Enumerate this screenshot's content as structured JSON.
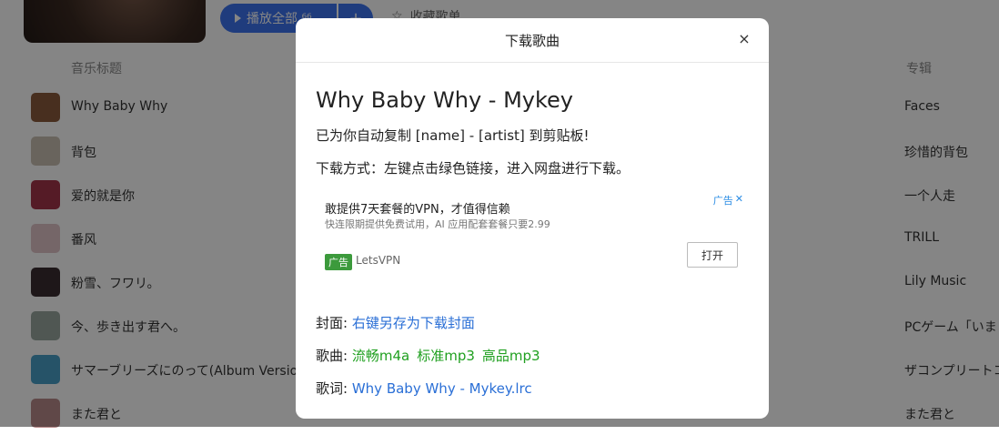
{
  "background": {
    "play_all_label": "播放全部 ⁶⁶",
    "add_label": "+",
    "favorite_label": "收藏歌单",
    "col_title_label": "音乐标题",
    "col_album_label": "专辑",
    "songs": [
      {
        "title": "Why Baby Why",
        "album": "Faces",
        "thumb_color": "#8a5a3c"
      },
      {
        "title": "背包",
        "album": "珍惜的背包",
        "thumb_color": "#c9c0b2"
      },
      {
        "title": "爱的就是你",
        "album": "一个人走",
        "thumb_color": "#a3344a"
      },
      {
        "title": "番风",
        "album": "TRILL",
        "thumb_color": "#e0c4c8"
      },
      {
        "title": "粉雪、フワリ。",
        "album": "Lily Music",
        "thumb_color": "#3a2c30"
      },
      {
        "title": "今、歩き出す君へ。",
        "album": "PCゲーム「いま",
        "thumb_color": "#9aa8a0"
      },
      {
        "title": "サマーブリーズにのって(Album Version",
        "album": "ザコンプリートコ",
        "thumb_color": "#4aa0c8"
      },
      {
        "title": "また君と",
        "album": "また君と",
        "thumb_color": "#b88a8a"
      }
    ]
  },
  "modal": {
    "title": "下载歌曲",
    "close_label": "×",
    "song_heading": "Why Baby Why - Mykey",
    "copy_notice": "已为你自动复制 [name] - [artist] 到剪贴板!",
    "download_hint": "下载方式：左键点击绿色链接，进入网盘进行下载。",
    "ad": {
      "title": "敢提供7天套餐的VPN，才值得信赖",
      "subtitle": "快连限期提供免费试用，AI 应用配套套餐只要2.99",
      "mark_label": "广告",
      "mark_close": "✕",
      "tag_label": "广告",
      "brand": "LetsVPN",
      "open_label": "打开"
    },
    "cover_label": "封面:",
    "cover_link": "右键另存为下载封面",
    "song_label": "歌曲:",
    "song_links": [
      "流畅m4a",
      "标准mp3",
      "高品mp3"
    ],
    "lyrics_label": "歌词:",
    "lyrics_link": "Why Baby Why - Mykey.lrc"
  }
}
